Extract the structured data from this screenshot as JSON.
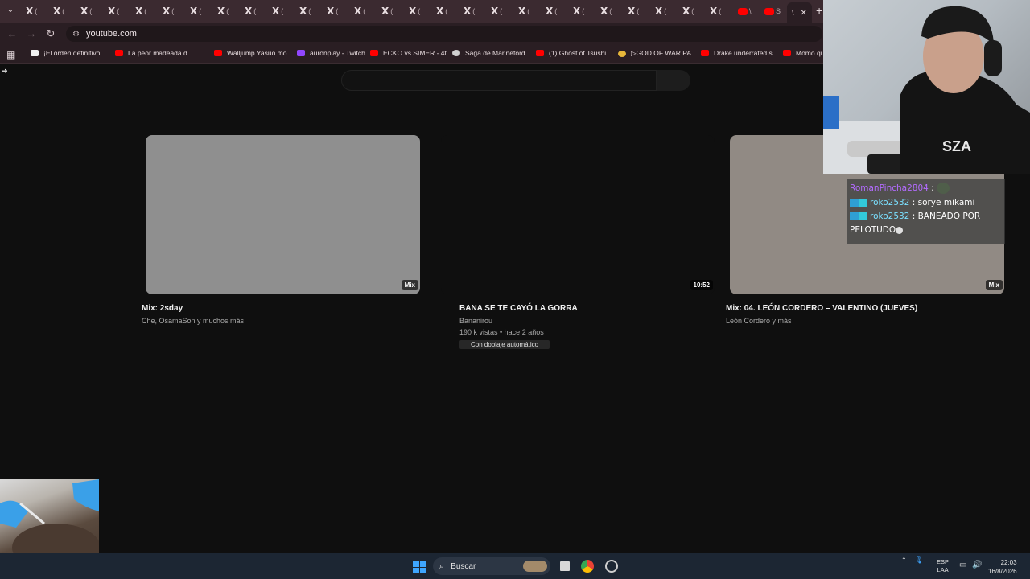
{
  "tabs": {
    "menu_label": "⌄",
    "x_tabs": [
      "X",
      "X",
      "X",
      "X",
      "X",
      "X",
      "X",
      "X",
      "X",
      "X",
      "X",
      "X",
      "X",
      "X",
      "X",
      "X",
      "X",
      "X",
      "X",
      "X",
      "X",
      "X",
      "X",
      "X",
      "X",
      "X"
    ],
    "x_tail": "(",
    "yt_tab_1_tail": "\\",
    "yt_tab_2_tail": "S",
    "active_tab_tail": "\\",
    "active_close": "✕",
    "new_tab": "+"
  },
  "toolbar": {
    "back": "←",
    "forward": "→",
    "reload": "↻",
    "site_icon": "⚙",
    "url": "youtube.com"
  },
  "bookmarks": [
    {
      "label": "¡El orden definitivo...",
      "icon": "doc"
    },
    {
      "label": "La peor madeada d...",
      "icon": "youtube"
    },
    {
      "label": "Walljump Yasuo mo...",
      "icon": "youtube"
    },
    {
      "label": "auronplay - Twitch",
      "icon": "twitch"
    },
    {
      "label": "ECKO vs SIMER - 4t...",
      "icon": "youtube"
    },
    {
      "label": "Saga de Marineford...",
      "icon": "gray"
    },
    {
      "label": "(1) Ghost of Tsushi...",
      "icon": "youtube"
    },
    {
      "label": "▷GOD OF WAR PA...",
      "icon": "gold"
    },
    {
      "label": "Drake underrated s...",
      "icon": "youtube"
    },
    {
      "label": "Momo qu",
      "icon": "youtube"
    }
  ],
  "videos": [
    {
      "title": "Mix: 2sday",
      "channel": "Che, OsamaSon y muchos más",
      "badge": "Mix",
      "thumb_color": "#8f8f8f"
    },
    {
      "title": "BANA SE TE CAYÓ LA GORRA",
      "channel": "Bananirou",
      "meta": "190 k vistas • hace 2 años",
      "dub": "Con doblaje automático",
      "badge": "10:52",
      "thumb_color": "#0f0f0f"
    },
    {
      "title": "Mix: 04. LEÓN CORDERO – VALENTINO (JUEVES)",
      "channel": "León Cordero y más",
      "badge": "Mix",
      "thumb_color": "#918a84"
    }
  ],
  "chat": [
    {
      "user": "RomanPincha2804",
      "user_color": "#b36cff",
      "text": "",
      "badges": false,
      "emote": true
    },
    {
      "user": "roko2532",
      "user_color": "#7be0ff",
      "text": "sorye mikami",
      "badges": true,
      "emote": false
    },
    {
      "user": "roko2532",
      "user_color": "#7be0ff",
      "text": "BANEADO POR PELOTUDO",
      "badges": true,
      "emote": true
    }
  ],
  "taskbar": {
    "search_label": "Buscar",
    "lang_top": "ESP",
    "lang_bottom": "LAA",
    "time": "22:03",
    "date": "16/8/2026"
  }
}
